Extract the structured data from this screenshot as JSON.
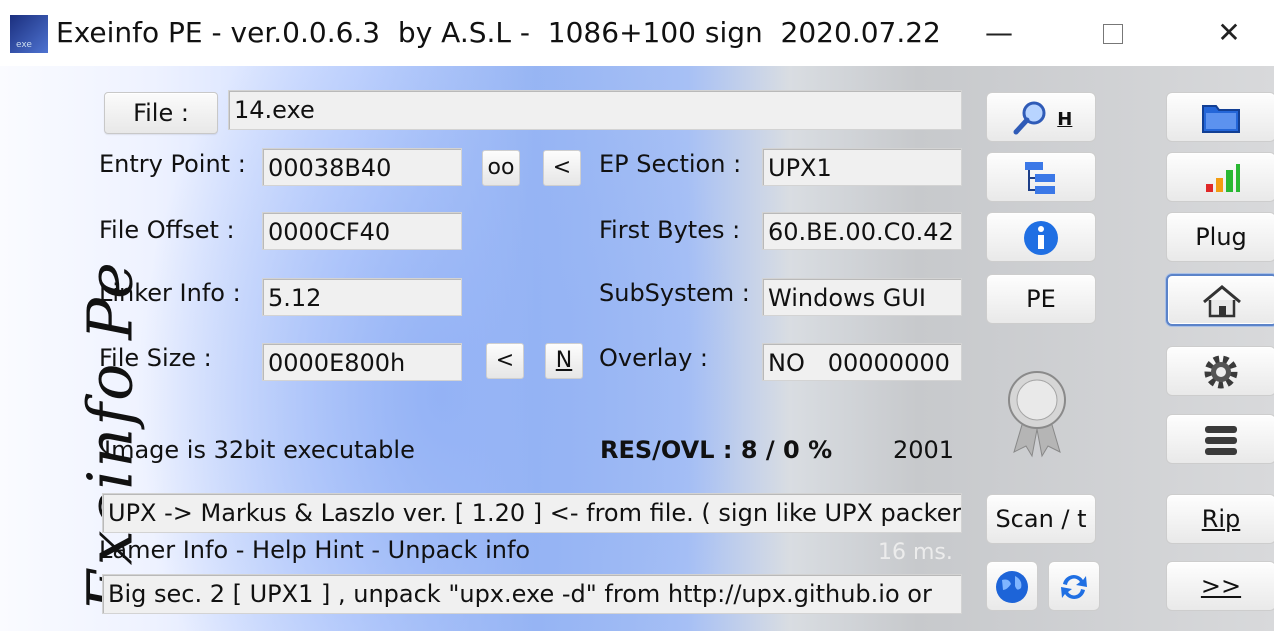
{
  "title": "Exeinfo PE - ver.0.0.6.3  by A.S.L -  1086+100 sign  2020.07.22",
  "window_controls": {
    "minimize": "—",
    "close": "✕"
  },
  "logo_text": "Exeinfo Pe",
  "file": {
    "button_label": "File :",
    "value": "14.exe"
  },
  "fields": {
    "entry_point": {
      "label": "Entry Point :",
      "value": "00038B40"
    },
    "file_offset": {
      "label": "File Offset :",
      "value": "0000CF40"
    },
    "linker_info": {
      "label": "Linker Info :",
      "value": "5.12"
    },
    "file_size": {
      "label": "File Size :",
      "value": "0000E800h"
    },
    "ep_section": {
      "label": "EP Section :",
      "value": "UPX1"
    },
    "first_bytes": {
      "label": "First Bytes :",
      "value": "60.BE.00.C0.42"
    },
    "subsystem": {
      "label": "SubSystem :",
      "value": "Windows GUI"
    },
    "overlay": {
      "label": "Overlay :",
      "value": "NO   00000000"
    }
  },
  "small_buttons": {
    "oo": "oo",
    "lt1": "<",
    "lt2": "<",
    "n": "N"
  },
  "image_info": "Image is 32bit executable",
  "res_ovl": "RES/OVL : 8 / 0 %",
  "year": "2001",
  "detect": "UPX -> Markus & Laszlo ver. [ 1.20 ] <- from file. ( sign like UPX packer",
  "lamer_info": "Lamer Info - Help Hint - Unpack info",
  "time": "16 ms.",
  "hint": "Big sec. 2 [ UPX1 ] , unpack \"upx.exe -d\"  from  http://upx.github.io or",
  "tools": {
    "h_label": "H",
    "pe": "PE",
    "scan": "Scan / t",
    "plug": "Plug",
    "rip": "Rip",
    "next": ">>"
  },
  "icons": [
    "magnifier-icon",
    "tree-icon",
    "info-icon",
    "folder-icon",
    "chart-icon",
    "home-icon",
    "gear-icon",
    "menu-icon",
    "globe-icon",
    "refresh-icon",
    "ribbon-icon"
  ]
}
